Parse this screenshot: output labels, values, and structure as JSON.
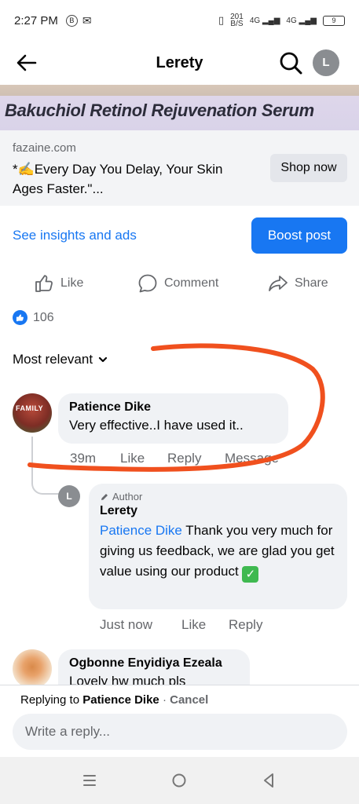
{
  "status_bar": {
    "time": "2:27 PM",
    "net_speed": "201",
    "net_speed_unit": "B/S",
    "signal_1": "4G",
    "signal_2": "4G",
    "battery": "9"
  },
  "header": {
    "title": "Lerety",
    "profile_initial": "L"
  },
  "ad": {
    "banner_title": "Bakuchiol Retinol Rejuvenation Serum",
    "domain": "fazaine.com",
    "text": "*✍️Every Day You Delay, Your Skin Ages Faster.\"...",
    "shop_button": "Shop now"
  },
  "post_tools": {
    "insights_link": "See insights and ads",
    "boost_button": "Boost post"
  },
  "actions": {
    "like": "Like",
    "comment": "Comment",
    "share": "Share"
  },
  "reactions": {
    "count": "106"
  },
  "sort": {
    "label": "Most relevant"
  },
  "comments": [
    {
      "avatar_text": "FAMILY",
      "name": "Patience Dike",
      "text": "Very effective..I have used it..",
      "time": "39m",
      "like": "Like",
      "reply": "Reply",
      "message": "Message"
    },
    {
      "name": "Ogbonne Enyidiya Ezeala",
      "text": "Lovely hw much pls"
    }
  ],
  "reply": {
    "avatar_initial": "L",
    "author_tag": "Author",
    "name": "Lerety",
    "mention": "Patience Dike",
    "text": " Thank you very much for giving us feedback, we are glad you get value using our product ",
    "time": "Just now",
    "like": "Like",
    "reply": "Reply"
  },
  "reply_box": {
    "prefix": "Replying to ",
    "target": "Patience Dike",
    "separator": " · ",
    "cancel": "Cancel",
    "placeholder": "Write a reply..."
  },
  "colors": {
    "accent": "#1877f2",
    "annotation": "#f0501e"
  }
}
